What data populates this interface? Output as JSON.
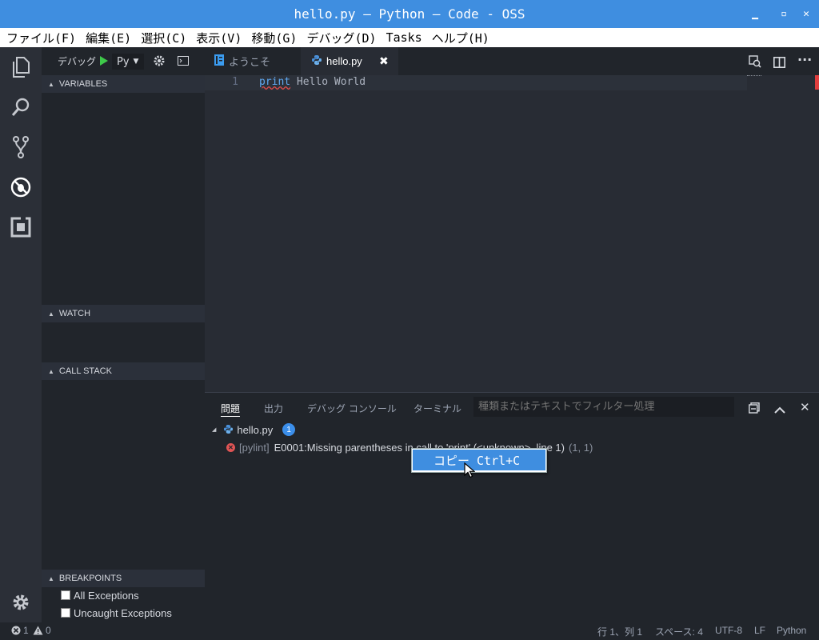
{
  "window": {
    "title": "hello.py — Python — Code - OSS"
  },
  "menu": [
    "ファイル(F)",
    "編集(E)",
    "選択(C)",
    "表示(V)",
    "移動(G)",
    "デバッグ(D)",
    "Tasks",
    "ヘルプ(H)"
  ],
  "debug_toolbar": {
    "label": "デバッグ",
    "config": "Py"
  },
  "sidebar": {
    "variables": "VARIABLES",
    "watch": "WATCH",
    "call_stack": "CALL STACK",
    "breakpoints": "BREAKPOINTS",
    "breakpoint_items": [
      "All Exceptions",
      "Uncaught Exceptions"
    ]
  },
  "tabs": [
    {
      "label": "ようこそ"
    },
    {
      "label": "hello.py"
    }
  ],
  "editor": {
    "line_number": "1",
    "keyword": "print",
    "rest": " Hello World"
  },
  "panel": {
    "tabs": [
      "問題",
      "出力",
      "デバッグ コンソール",
      "ターミナル"
    ],
    "filter_placeholder": "種類またはテキストでフィルター処理",
    "file": "hello.py",
    "count": "1",
    "problem": {
      "source": "[pylint]",
      "message": "E0001:Missing parentheses in call to 'print' (<unknown>, line 1)",
      "location": "(1, 1)"
    }
  },
  "context_menu": {
    "item": "コピー Ctrl+C"
  },
  "status": {
    "errors": "1",
    "warnings": "0",
    "position": "行 1、列 1",
    "spaces": "スペース: 4",
    "encoding": "UTF-8",
    "eol": "LF",
    "language": "Python"
  }
}
